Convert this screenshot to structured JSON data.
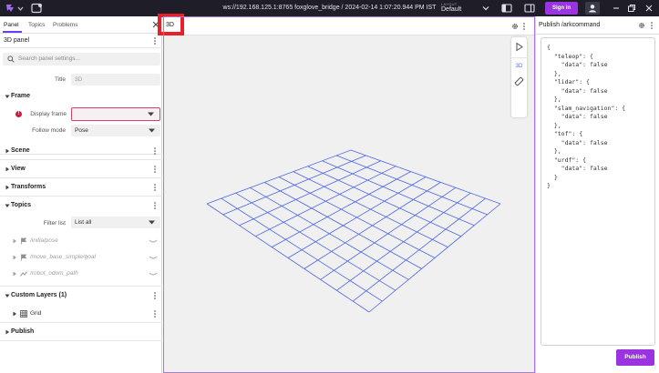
{
  "topbar": {
    "connection_title": "ws://192.168.125.1:8765 foxglove_bridge / 2024-02-14 1:07:20.944 PM IST",
    "layout_label": "LAYOUT",
    "layout_value": "Default",
    "signin_label": "Sign in",
    "accent": "#9a34e0",
    "background": "#1e1d28"
  },
  "left_panel": {
    "tabs": [
      {
        "label": "Panel"
      },
      {
        "label": "Topics"
      },
      {
        "label": "Problems"
      }
    ],
    "header_title": "3D panel",
    "search_placeholder": "Search panel settings...",
    "title_label": "Title",
    "title_value": "3D",
    "frame": {
      "label": "Frame",
      "display_frame_label": "Display frame",
      "display_frame_value": "",
      "follow_mode_label": "Follow mode",
      "follow_mode_value": "Pose",
      "error_glyph": "!"
    },
    "sections": [
      "Scene",
      "View",
      "Transforms"
    ],
    "topics": {
      "label": "Topics",
      "filter_label": "Filter list",
      "filter_value": "List all",
      "items": [
        {
          "name": "/initialpose",
          "icon": "flag-icon"
        },
        {
          "name": "/move_base_simple/goal",
          "icon": "flag-icon"
        },
        {
          "name": "/robot_odom_path",
          "icon": "path-icon"
        }
      ]
    },
    "custom_layers": {
      "label": "Custom Layers (1)",
      "items": [
        {
          "name": "Grid",
          "icon": "grid-icon"
        }
      ]
    },
    "publish_label": "Publish"
  },
  "viewport": {
    "panel_title": "3D",
    "toolbar_label": "3D",
    "grid_color": "#4a66e0",
    "background": "#f1f0f0"
  },
  "right_panel": {
    "title": "Publish /arkcommand",
    "message_lines": [
      "{",
      "  \"teleop\": {",
      "    \"data\": false",
      "  },",
      "  \"lidar\": {",
      "    \"data\": false",
      "  },",
      "  \"slam_navigation\": {",
      "    \"data\": false",
      "  },",
      "  \"tof\": {",
      "    \"data\": false",
      "  },",
      "  \"urdf\": {",
      "    \"data\": false",
      "  }",
      "}"
    ],
    "publish_button_label": "Publish"
  }
}
